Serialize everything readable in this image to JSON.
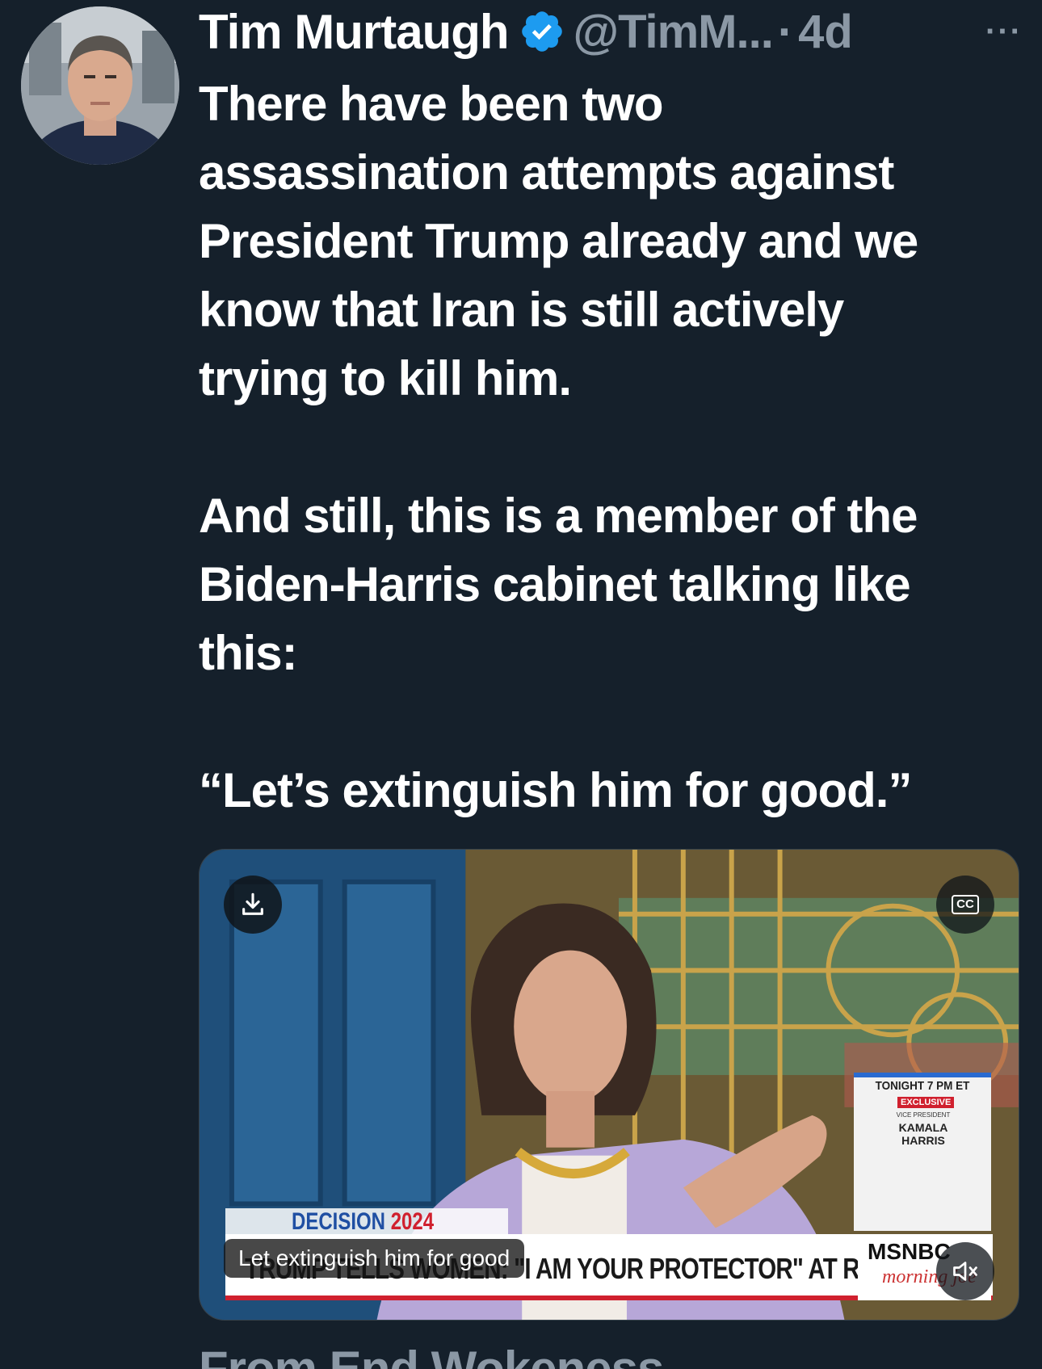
{
  "author": {
    "name": "Tim Murtaugh",
    "handle": "@TimM...",
    "separator": "·",
    "time": "4d",
    "verified_badge_color": "#1d9bf0"
  },
  "more_label": "···",
  "tweet_text": {
    "paragraph_1_lines": [
      "There have been two",
      "assassination attempts against",
      "President Trump already and we",
      "know that Iran is still actively",
      "trying to kill him."
    ],
    "paragraph_2_lines": [
      "And still, this is a member of the",
      "Biden-Harris cabinet talking like",
      "this:"
    ],
    "paragraph_3_lines": [
      "“Let’s extinguish him for good.”"
    ]
  },
  "video": {
    "download_icon": "download-icon",
    "cc_label": "CC",
    "caption": "Let extinguish him for good",
    "chyron": "TRUMP TELLS WOMEN: \"I AM YOUR PROTECTOR\" AT RALLY",
    "decision_label": "DECISION",
    "decision_year": "2024",
    "network": "MSNBC",
    "show": "morning joe",
    "promo": {
      "time": "TONIGHT 7 PM ET",
      "badge": "EXCLUSIVE",
      "subtitle": "VICE PRESIDENT",
      "name_line1": "KAMALA",
      "name_line2": "HARRIS"
    },
    "mute_icon": "muted-speaker-icon"
  },
  "next_tweet_preview": "From End Wokeness",
  "colors": {
    "background": "#15202b",
    "secondary_text": "#8b98a5",
    "primary_text": "#ffffff",
    "accent": "#1d9bf0"
  }
}
